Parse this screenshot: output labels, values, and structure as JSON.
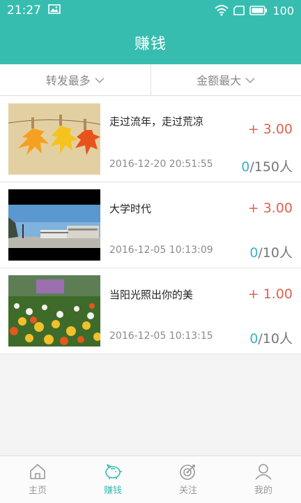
{
  "status_bar": {
    "time": "21:27",
    "battery": "100",
    "icons": [
      "image-icon",
      "wifi-icon",
      "sim-icon",
      "battery-icon"
    ]
  },
  "header": {
    "title": "赚钱"
  },
  "sort": {
    "options": [
      {
        "label": "转发最多",
        "icon": "chevron-down-icon"
      },
      {
        "label": "金额最大",
        "icon": "chevron-down-icon"
      }
    ]
  },
  "items": [
    {
      "title": "走过流年，走过荒凉",
      "reward": "+ 3.00",
      "date": "2016-12-20 20:51:55",
      "count_current": "0",
      "count_total": "/150人"
    },
    {
      "title": "大学时代",
      "reward": "+ 3.00",
      "date": "2016-12-05 10:13:09",
      "count_current": "0",
      "count_total": "/10人"
    },
    {
      "title": "当阳光照出你的美",
      "reward": "+ 1.00",
      "date": "2016-12-05 10:13:15",
      "count_current": "0",
      "count_total": "/10人"
    }
  ],
  "tabs": [
    {
      "label": "主页",
      "icon": "home-icon"
    },
    {
      "label": "赚钱",
      "icon": "piggy-bank-icon",
      "active": true
    },
    {
      "label": "关注",
      "icon": "target-icon"
    },
    {
      "label": "我的",
      "icon": "user-icon"
    }
  ],
  "colors": {
    "primary": "#36bdb0",
    "reward": "#e0614f",
    "count_accent": "#35b5c8"
  }
}
